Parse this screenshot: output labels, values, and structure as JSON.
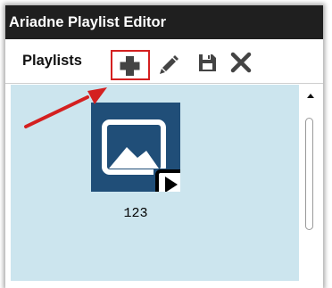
{
  "window": {
    "title": "Ariadne Playlist Editor"
  },
  "toolbar": {
    "label": "Playlists",
    "buttons": [
      {
        "name": "add",
        "icon": "plus-icon"
      },
      {
        "name": "edit",
        "icon": "pencil-icon"
      },
      {
        "name": "save",
        "icon": "floppy-disk-icon"
      },
      {
        "name": "delete",
        "icon": "x-icon"
      }
    ],
    "highlight_color": "#d42020"
  },
  "playlists": [
    {
      "label": "123",
      "thumbnail_color": "#204e78"
    }
  ],
  "colors": {
    "titlebar": "#1f1f1f",
    "content_background": "#cce5ee",
    "icon": "#444444",
    "annotation_arrow": "#d42020"
  }
}
